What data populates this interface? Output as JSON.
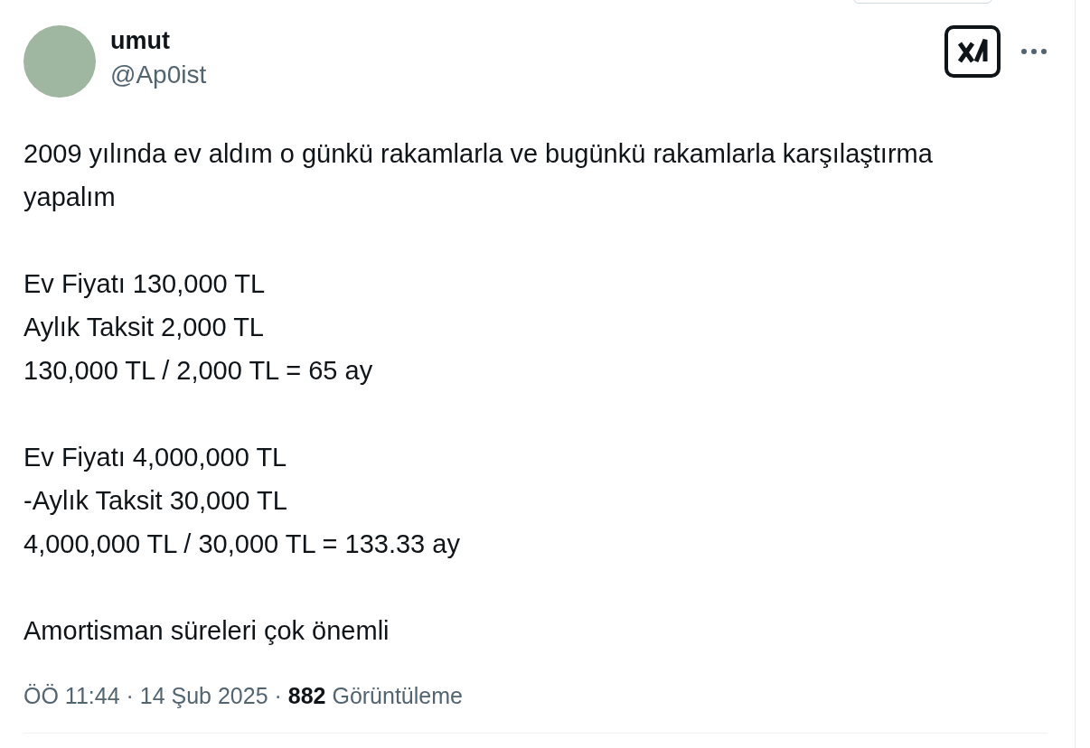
{
  "author": {
    "name": "umut",
    "handle": "@Ap0ist"
  },
  "paragraphs": [
    [
      "2009 yılında ev aldım o günkü rakamlarla ve bugünkü rakamlarla karşılaştırma yapalım"
    ],
    [
      "Ev Fiyatı 130,000 TL",
      "Aylık Taksit 2,000 TL",
      "130,000 TL / 2,000 TL = 65 ay"
    ],
    [
      "Ev Fiyatı 4,000,000 TL",
      "-Aylık Taksit 30,000 TL",
      "4,000,000 TL / 30,000 TL = 133.33 ay"
    ],
    [
      "Amortisman süreleri çok önemli"
    ]
  ],
  "meta": "ÖÖ 11:44 · 14 Şub 2025 · **882** Görüntüleme"
}
